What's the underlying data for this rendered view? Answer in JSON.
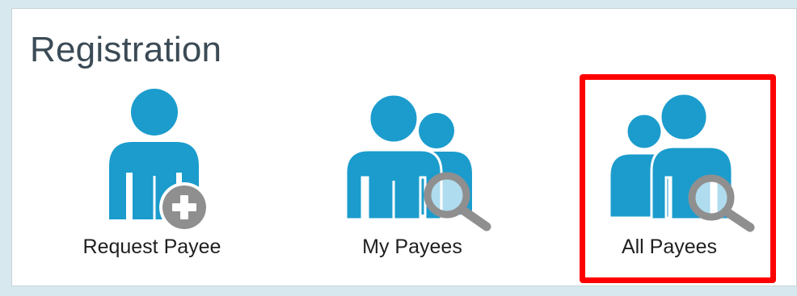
{
  "section": {
    "title": "Registration"
  },
  "tiles": [
    {
      "label": "Request Payee",
      "icon": "person-add-icon"
    },
    {
      "label": "My Payees",
      "icon": "people-search-icon"
    },
    {
      "label": "All Payees",
      "icon": "people-search-icon"
    }
  ],
  "colors": {
    "person": "#1b9ccd",
    "badge": "#8f8f8f",
    "highlight": "#ff0000"
  }
}
